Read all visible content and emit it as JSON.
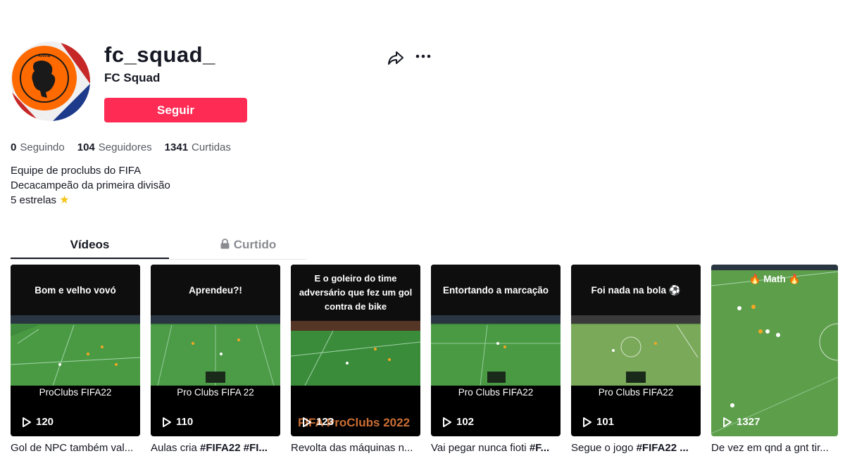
{
  "profile": {
    "username": "fc_squad_",
    "nickname": "FC Squad",
    "follow_label": "Seguir",
    "stats": [
      {
        "value": "0",
        "label": "Seguindo"
      },
      {
        "value": "104",
        "label": "Seguidores"
      },
      {
        "value": "1341",
        "label": "Curtidas"
      }
    ],
    "bio": [
      "Equipe de proclubs do FIFA",
      "Decacampeão da primeira divisão",
      "5 estrelas"
    ],
    "bio_icon": "star-emoji"
  },
  "tabs": {
    "videos": "Vídeos",
    "liked": "Curtido"
  },
  "videos": [
    {
      "overlay": "Bom e velho vovó",
      "bottom_label": "ProClubs FIFA22",
      "plays": "120",
      "caption_plain": "Gol de NPC também val...",
      "caption_tag": ""
    },
    {
      "overlay": "Aprendeu?!",
      "bottom_label": "Pro Clubs FIFA 22",
      "plays": "110",
      "caption_plain": "Aulas cria ",
      "caption_tag": "#FIFA22 #FI..."
    },
    {
      "overlay": "E o goleiro do time adversário que fez um gol contra de bike",
      "bottom_label": "FIFA ProClubs 2022",
      "plays": "123",
      "caption_plain": "Revolta das máquinas n...",
      "caption_tag": ""
    },
    {
      "overlay": "Entortando a marcação",
      "bottom_label": "Pro Clubs FIFA22",
      "plays": "102",
      "caption_plain": "Vai pegar nunca fioti ",
      "caption_tag": "#F..."
    },
    {
      "overlay": "Foi nada na bola ⚽",
      "bottom_label": "Pro Clubs FIFA22",
      "plays": "101",
      "caption_plain": "Segue o jogo ",
      "caption_tag": "#FIFA22 ..."
    },
    {
      "overlay": "🔥 Math 🔥",
      "bottom_label": "",
      "plays": "1327",
      "caption_plain": "De vez em qnd a gnt tir...",
      "caption_tag": ""
    }
  ],
  "colors": {
    "accent": "#fe2c55",
    "pitch": "#3f8a3c"
  }
}
